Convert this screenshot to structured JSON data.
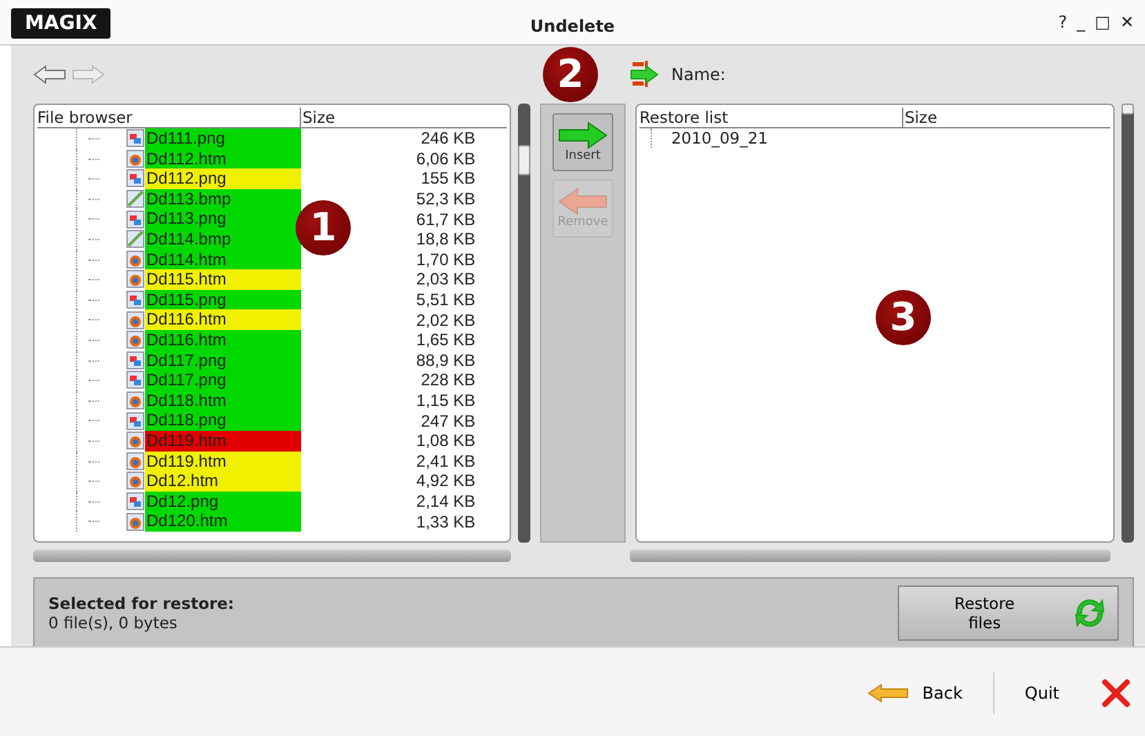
{
  "window": {
    "logo": "MAGIX",
    "title": "Undelete",
    "controls": [
      "?",
      "_",
      "□",
      "✕"
    ]
  },
  "toolbar": {
    "name_label": "Name:"
  },
  "file_browser": {
    "columns": [
      "File browser",
      "Size"
    ],
    "rows": [
      {
        "name": "Dd111.png",
        "size": "246 KB",
        "kind": "png",
        "color": "#00d800"
      },
      {
        "name": "Dd112.htm",
        "size": "6,06 KB",
        "kind": "htm",
        "color": "#00d800"
      },
      {
        "name": "Dd112.png",
        "size": "155 KB",
        "kind": "png",
        "color": "#f0f000"
      },
      {
        "name": "Dd113.bmp",
        "size": "52,3 KB",
        "kind": "bmp",
        "color": "#00d800"
      },
      {
        "name": "Dd113.png",
        "size": "61,7 KB",
        "kind": "png",
        "color": "#00d800"
      },
      {
        "name": "Dd114.bmp",
        "size": "18,8 KB",
        "kind": "bmp",
        "color": "#00d800"
      },
      {
        "name": "Dd114.htm",
        "size": "1,70 KB",
        "kind": "htm",
        "color": "#00d800"
      },
      {
        "name": "Dd115.htm",
        "size": "2,03 KB",
        "kind": "htm",
        "color": "#f0f000"
      },
      {
        "name": "Dd115.png",
        "size": "5,51 KB",
        "kind": "png",
        "color": "#00d800"
      },
      {
        "name": "Dd116.htm",
        "size": "2,02 KB",
        "kind": "htm",
        "color": "#f0f000"
      },
      {
        "name": "Dd116.htm",
        "size": "1,65 KB",
        "kind": "htm",
        "color": "#00d800"
      },
      {
        "name": "Dd117.png",
        "size": "88,9 KB",
        "kind": "png",
        "color": "#00d800"
      },
      {
        "name": "Dd117.png",
        "size": "228 KB",
        "kind": "png",
        "color": "#00d800"
      },
      {
        "name": "Dd118.htm",
        "size": "1,15 KB",
        "kind": "htm",
        "color": "#00d800"
      },
      {
        "name": "Dd118.png",
        "size": "247 KB",
        "kind": "png",
        "color": "#00d800"
      },
      {
        "name": "Dd119.htm",
        "size": "1,08 KB",
        "kind": "htm",
        "color": "#e00000"
      },
      {
        "name": "Dd119.htm",
        "size": "2,41 KB",
        "kind": "htm",
        "color": "#f0f000"
      },
      {
        "name": "Dd12.htm",
        "size": "4,92 KB",
        "kind": "htm",
        "color": "#f0f000"
      },
      {
        "name": "Dd12.png",
        "size": "2,14 KB",
        "kind": "png",
        "color": "#00d800"
      },
      {
        "name": "Dd120.htm",
        "size": "1,33 KB",
        "kind": "htm",
        "color": "#00d800"
      }
    ]
  },
  "transfer": {
    "insert": {
      "label": "Insert",
      "disabled": false
    },
    "remove": {
      "label": "Remove",
      "disabled": true
    }
  },
  "restore_list": {
    "columns": [
      "Restore list",
      "Size"
    ],
    "items": [
      "2010_09_21"
    ]
  },
  "status": {
    "title": "Selected for restore:",
    "summary": "0 file(s),  0 bytes",
    "restore_button": "Restore\nfiles"
  },
  "footer": {
    "back": "Back",
    "quit": "Quit"
  },
  "callouts": [
    "1",
    "2",
    "3"
  ]
}
